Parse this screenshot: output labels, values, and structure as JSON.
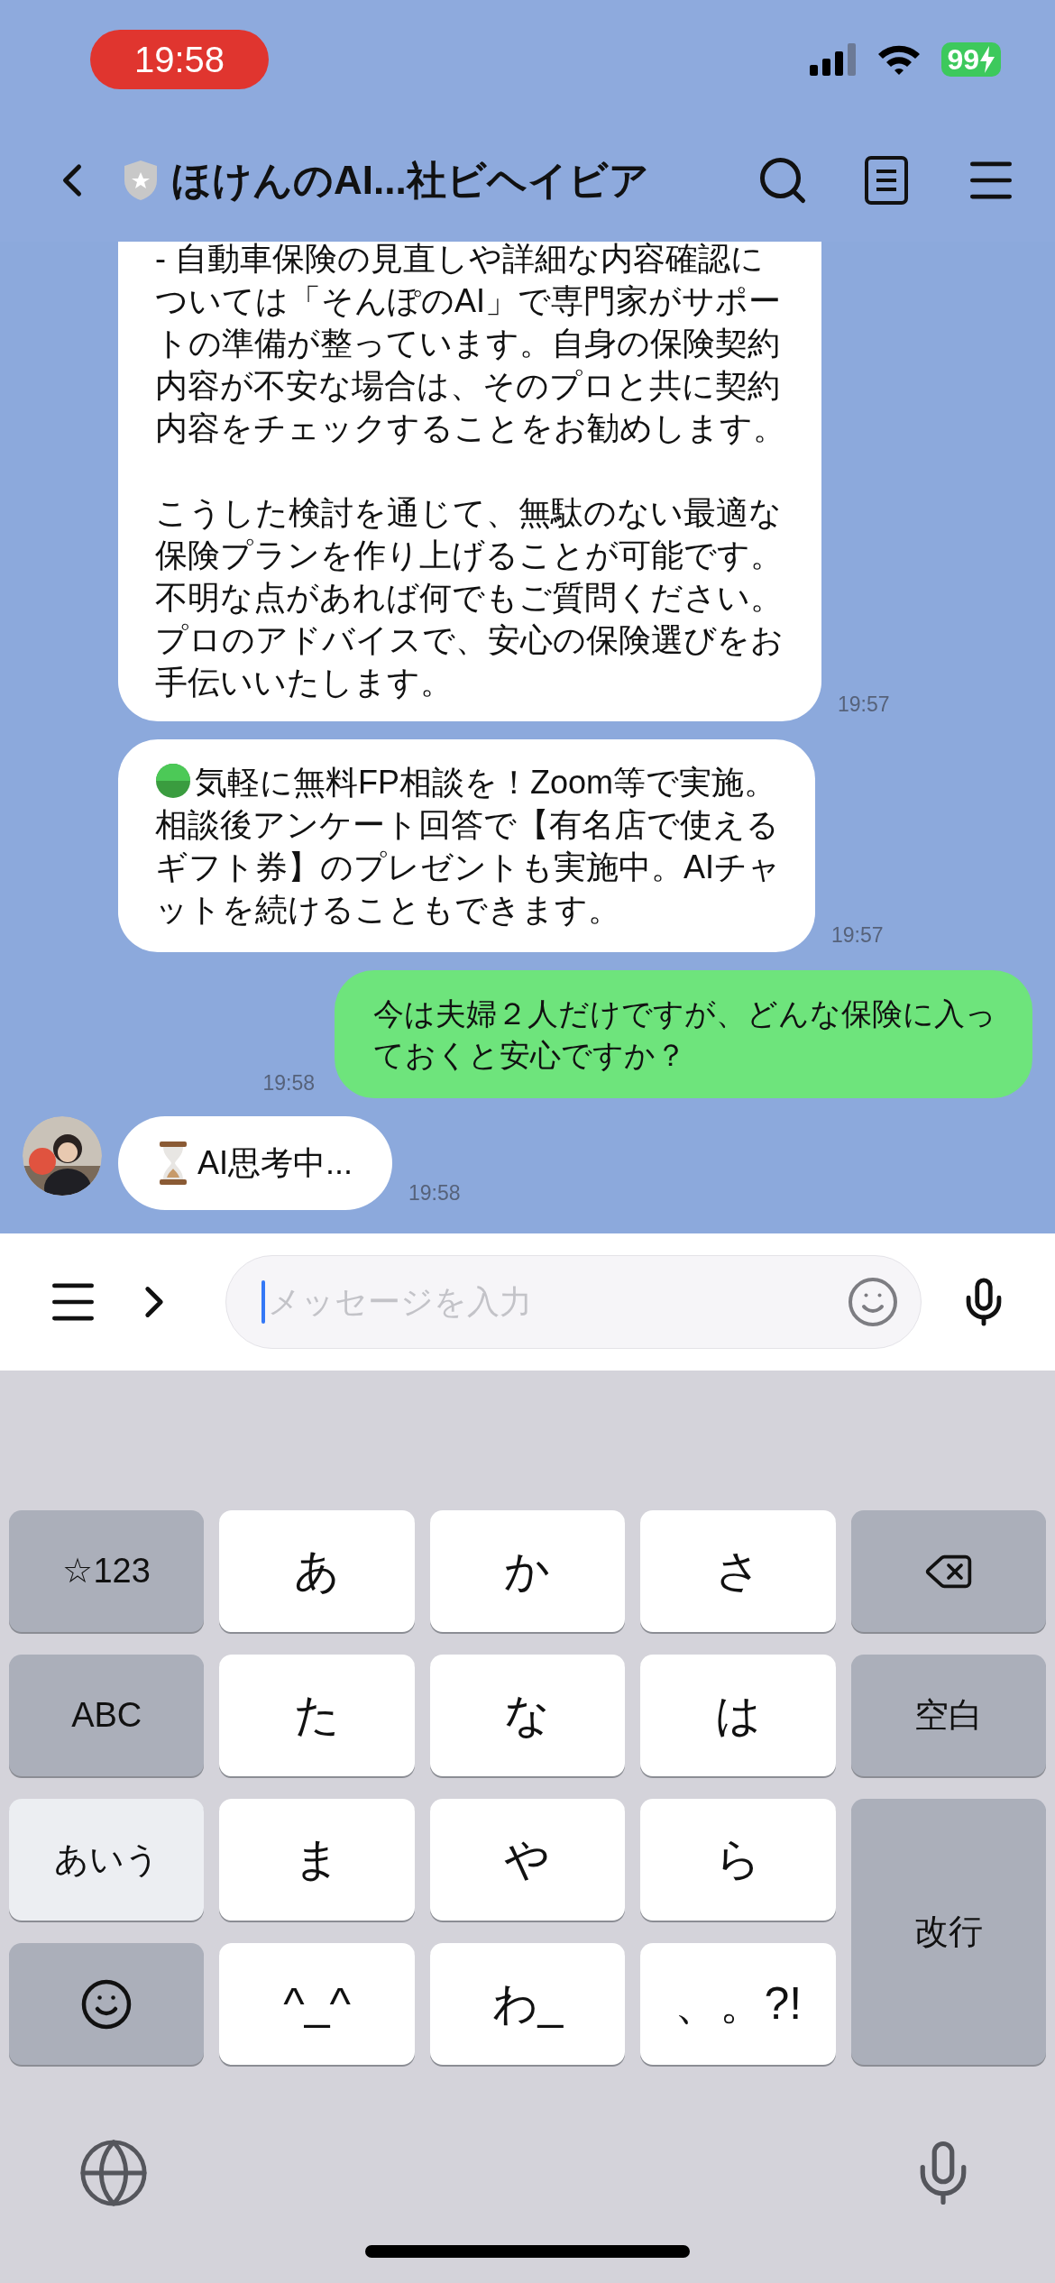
{
  "status_bar": {
    "time": "19:58",
    "battery": "99"
  },
  "header": {
    "title": "ほけんのAI...社ビヘイビア"
  },
  "messages": [
    {
      "kind": "text",
      "avatar": false,
      "paragraphs": [
        "- 自動車保険の見直しや詳細な内容確認については「そんぽのAI」で専門家がサポートの準備が整っています。自身の保険契約内容が不安な場合は、そのプロと共に契約内容をチェックすることをお勧めします。",
        "こうした検討を通じて、無駄のない最適な保険プランを作り上げることが可能です。不明な点があれば何でもご質問ください。プロのアドバイスで、安心の保険選びをお手伝いいたします。"
      ],
      "time": "19:57"
    },
    {
      "kind": "notice",
      "avatar": false,
      "text": "気軽に無料FP相談を！Zoom等で実施。相談後アンケート回答で【有名店で使えるギフト券】のプレゼントも実施中。AIチャットを続けることもできます。",
      "time": "19:57"
    },
    {
      "kind": "sent",
      "text": "今は夫婦２人だけですが、どんな保険に入っておくと安心ですか？",
      "time": "19:58"
    },
    {
      "kind": "thinking",
      "avatar": true,
      "text": "AI思考中...",
      "time": "19:58"
    }
  ],
  "input": {
    "placeholder": "メッセージを入力"
  },
  "keyboard": {
    "keys": [
      {
        "label": "☆123",
        "kind": "function"
      },
      {
        "label": "あ",
        "kind": "char"
      },
      {
        "label": "か",
        "kind": "char"
      },
      {
        "label": "さ",
        "kind": "char"
      },
      {
        "kind": "delete"
      },
      {
        "label": "ABC",
        "kind": "function"
      },
      {
        "label": "た",
        "kind": "char"
      },
      {
        "label": "な",
        "kind": "char"
      },
      {
        "label": "は",
        "kind": "char"
      },
      {
        "label": "空白",
        "kind": "function"
      },
      {
        "label": "あいう",
        "kind": "active"
      },
      {
        "label": "ま",
        "kind": "char"
      },
      {
        "label": "や",
        "kind": "char"
      },
      {
        "label": "ら",
        "kind": "char"
      },
      {
        "label": "改行",
        "kind": "return"
      },
      {
        "kind": "emoji"
      },
      {
        "label": "^_^",
        "kind": "char"
      },
      {
        "label": "わ_",
        "kind": "char"
      },
      {
        "label": "、。?!",
        "kind": "char"
      }
    ]
  }
}
